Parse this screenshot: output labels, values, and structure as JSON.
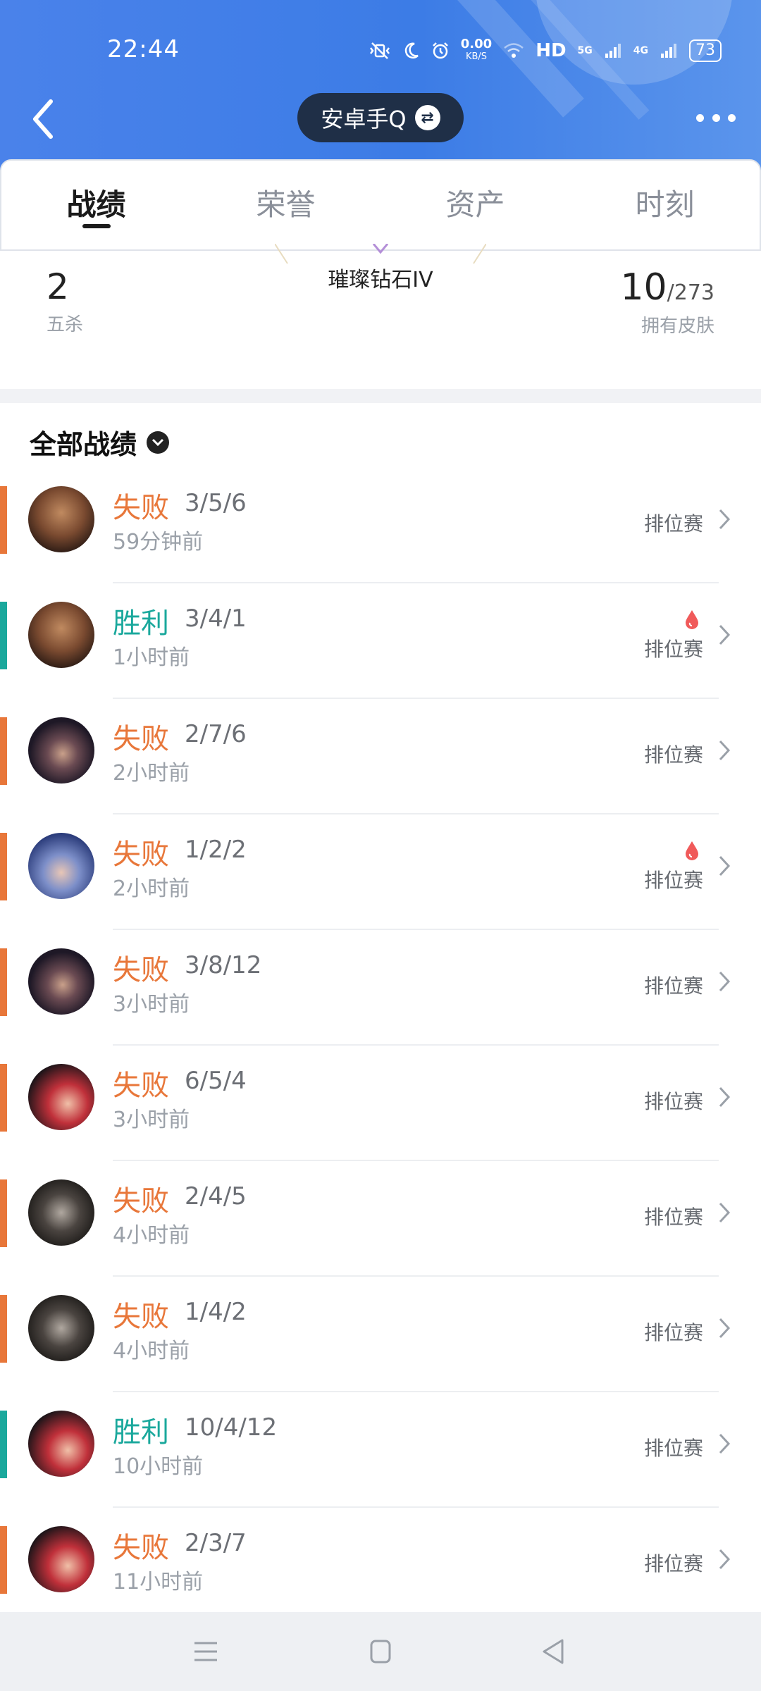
{
  "status_bar": {
    "time": "22:44",
    "speed_value": "0.00",
    "speed_unit": "KB/S",
    "hd": "HD",
    "net1": "5G",
    "net2": "4G",
    "battery": "73"
  },
  "nav": {
    "title": "安卓手Q",
    "swap_icon": "⇄"
  },
  "tabs": [
    {
      "label": "战绩",
      "active": true
    },
    {
      "label": "荣誉",
      "active": false
    },
    {
      "label": "资产",
      "active": false
    },
    {
      "label": "时刻",
      "active": false
    }
  ],
  "stats": {
    "pentakills_value": "2",
    "pentakills_label": "五杀",
    "rank": "璀璨钻石IV",
    "skins_owned": "10",
    "skins_total": "/273",
    "skins_label": "拥有皮肤"
  },
  "section": {
    "title": "全部战绩"
  },
  "colors": {
    "loss": "#e8773a",
    "win": "#1aa89c",
    "header_blue": "#3c7ce6",
    "pill_dark": "#1f2f47"
  },
  "matches": [
    {
      "result": "失败",
      "kda": "3/5/6",
      "ago": "59分钟前",
      "mode": "排位赛",
      "first_blood": false,
      "champion_icon": "champion-draven-avatar"
    },
    {
      "result": "胜利",
      "kda": "3/4/1",
      "ago": "1小时前",
      "mode": "排位赛",
      "first_blood": true,
      "champion_icon": "champion-draven-avatar"
    },
    {
      "result": "失败",
      "kda": "2/7/6",
      "ago": "2小时前",
      "mode": "排位赛",
      "first_blood": false,
      "champion_icon": "champion-dark-hair-avatar"
    },
    {
      "result": "失败",
      "kda": "1/2/2",
      "ago": "2小时前",
      "mode": "排位赛",
      "first_blood": true,
      "champion_icon": "champion-ashe-avatar"
    },
    {
      "result": "失败",
      "kda": "3/8/12",
      "ago": "3小时前",
      "mode": "排位赛",
      "first_blood": false,
      "champion_icon": "champion-dark-hair-avatar"
    },
    {
      "result": "失败",
      "kda": "6/5/4",
      "ago": "3小时前",
      "mode": "排位赛",
      "first_blood": false,
      "champion_icon": "champion-miss-fortune-avatar"
    },
    {
      "result": "失败",
      "kda": "2/4/5",
      "ago": "4小时前",
      "mode": "排位赛",
      "first_blood": false,
      "champion_icon": "champion-masked-avatar"
    },
    {
      "result": "失败",
      "kda": "1/4/2",
      "ago": "4小时前",
      "mode": "排位赛",
      "first_blood": false,
      "champion_icon": "champion-masked-avatar"
    },
    {
      "result": "胜利",
      "kda": "10/4/12",
      "ago": "10小时前",
      "mode": "排位赛",
      "first_blood": false,
      "champion_icon": "champion-miss-fortune-avatar"
    },
    {
      "result": "失败",
      "kda": "2/3/7",
      "ago": "11小时前",
      "mode": "排位赛",
      "first_blood": false,
      "champion_icon": "champion-miss-fortune-avatar"
    }
  ]
}
